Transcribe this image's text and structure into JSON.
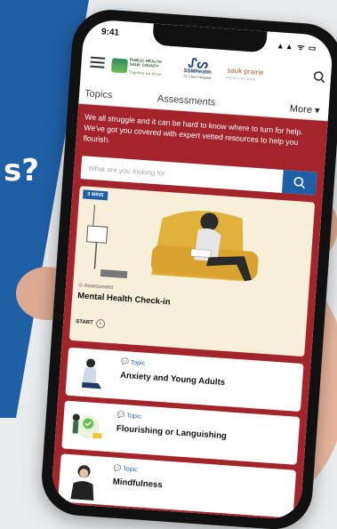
{
  "side": {
    "question_fragment": "s?",
    "bottom_fragment": ""
  },
  "status": {
    "time": "9:41",
    "icons": "▲▲ ᯤ ▭"
  },
  "logos": {
    "logo1": "PUBLIC HEALTH SAUK COUNTY",
    "logo1_sub": "Together we thrive",
    "logo2": "SSMHealth",
    "logo2_sub": "St. Clare Hospital",
    "logo3": "sauk prairie",
    "logo3_sub": "HEALTHCARE"
  },
  "tabs": {
    "topics": "Topics",
    "assessments": "Assessments",
    "more": "More ▾"
  },
  "intro": "We all struggle and it can be hard to know where to turn for help. We've got you covered with expert vetted resources to help you flourish.",
  "search": {
    "placeholder": "What are you looking for"
  },
  "featured": {
    "badge": "3 MINS",
    "tag": "Assessment",
    "title": "Mental Health Check-in",
    "start": "START"
  },
  "topics": [
    {
      "tag": "Topic",
      "title": "Anxiety and Young Adults"
    },
    {
      "tag": "Topic",
      "title": "Flourishing or Languishing"
    },
    {
      "tag": "Topic",
      "title": "Mindfulness"
    }
  ],
  "colors": {
    "accent_red": "#a3252b",
    "accent_blue": "#1f5fa6"
  }
}
